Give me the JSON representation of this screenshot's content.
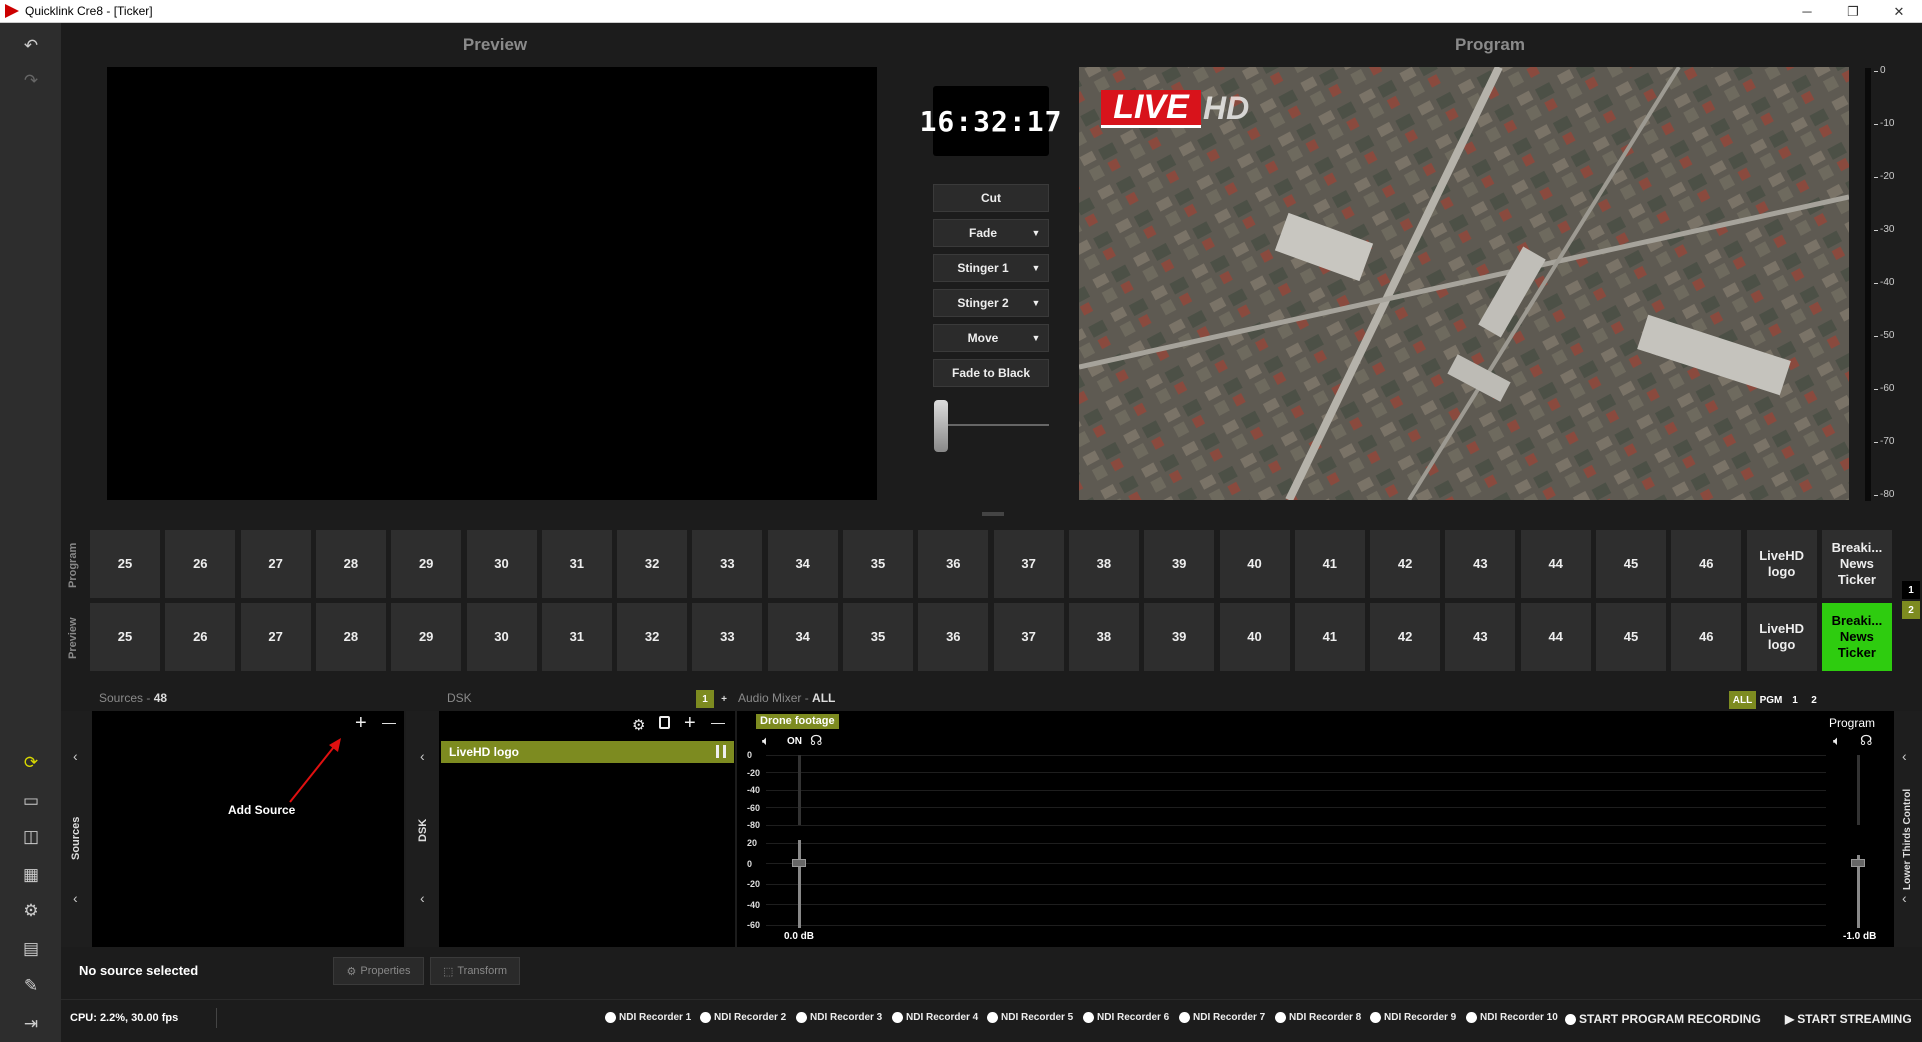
{
  "window": {
    "title": "Quicklink Cre8  - [Ticker]",
    "minimize": "─",
    "restore": "❐",
    "close": "✕"
  },
  "headers": {
    "preview": "Preview",
    "program": "Program"
  },
  "clock": "16:32:17",
  "transitions": [
    {
      "label": "Cut",
      "dropdown": false
    },
    {
      "label": "Fade",
      "dropdown": true
    },
    {
      "label": "Stinger 1",
      "dropdown": true
    },
    {
      "label": "Stinger 2",
      "dropdown": true
    },
    {
      "label": "Move",
      "dropdown": true
    },
    {
      "label": "Fade to Black",
      "dropdown": false
    }
  ],
  "program_overlay": {
    "live": "LIVE",
    "hd": "HD"
  },
  "meter_labels": [
    "0",
    "-10",
    "-20",
    "-30",
    "-40",
    "-50",
    "-60",
    "-70",
    "-80"
  ],
  "row_labels": {
    "program": "Program",
    "preview": "Preview"
  },
  "source_buttons": [
    "25",
    "26",
    "27",
    "28",
    "29",
    "30",
    "31",
    "32",
    "33",
    "34",
    "35",
    "36",
    "37",
    "38",
    "39",
    "40",
    "41",
    "42",
    "43",
    "44",
    "45",
    "46",
    "LiveHD logo",
    "Breaki... News Ticker"
  ],
  "active_preview": "Breaki... News Ticker",
  "pages": [
    "1",
    "2"
  ],
  "sources": {
    "label": "Sources",
    "count": "48",
    "side_label": "Sources",
    "add_hint": "Add Source",
    "plus": "+",
    "minus": "—"
  },
  "dsk": {
    "label": "DSK",
    "page": "1",
    "plus": "+",
    "side_label": "DSK",
    "items": [
      "LiveHD logo"
    ]
  },
  "audio": {
    "label": "Audio Mixer",
    "filter": "ALL",
    "filter_buttons": [
      "ALL",
      "PGM",
      "1",
      "2"
    ],
    "channel": {
      "name": "Drone footage",
      "on": "ON",
      "db": "0.0 dB"
    },
    "program": {
      "name": "Program",
      "db": "-1.0 dB"
    },
    "scale_top": [
      "0",
      "-20",
      "-40",
      "-60",
      "-80"
    ],
    "scale_bottom": [
      "20",
      "0",
      "-20",
      "-40",
      "-60"
    ]
  },
  "lower_thirds": "Lower Thirds Control",
  "bottom": {
    "no_source": "No source selected",
    "properties": "Properties",
    "transform": "Transform"
  },
  "status": {
    "cpu": "CPU: 2.2%, 30.00 fps",
    "recorders": [
      "NDI Recorder 1",
      "NDI Recorder 2",
      "NDI Recorder 3",
      "NDI Recorder 4",
      "NDI Recorder 5",
      "NDI Recorder 6",
      "NDI Recorder 7",
      "NDI Recorder 8",
      "NDI Recorder 9",
      "NDI Recorder 10"
    ],
    "start_program_recording": "START PROGRAM RECORDING",
    "start_streaming": "START STREAMING"
  },
  "colors": {
    "accent_green": "#2ecc0f",
    "dsk_olive": "#7d8b20",
    "live_red": "#d8131b"
  }
}
